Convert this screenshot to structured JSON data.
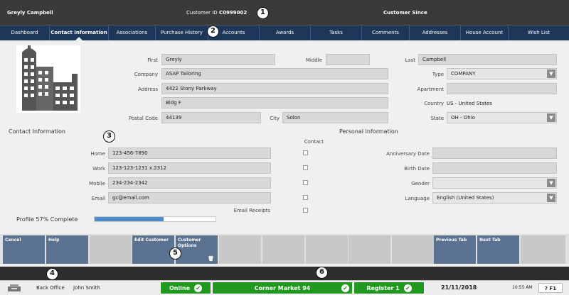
{
  "header": {
    "customer_name": "Greyly Campbell",
    "customer_id_label": "Customer ID",
    "customer_id": "C0999002",
    "customer_since_label": "Customer Since"
  },
  "callouts": [
    "1",
    "2",
    "3",
    "4",
    "5",
    "6"
  ],
  "tabs": [
    {
      "label": "Dashboard"
    },
    {
      "label": "Contact Information",
      "active": true
    },
    {
      "label": "Associations"
    },
    {
      "label": "Purchase History"
    },
    {
      "label": "Accounts"
    },
    {
      "label": "Awards"
    },
    {
      "label": "Tasks"
    },
    {
      "label": "Comments"
    },
    {
      "label": "Addresses"
    },
    {
      "label": "House Account"
    },
    {
      "label": "Wish List"
    }
  ],
  "avatar": "building-image",
  "form": {
    "first_label": "First",
    "first": "Greyly",
    "middle_label": "Middle",
    "middle": "",
    "last_label": "Last",
    "last": "Campbell",
    "company_label": "Company",
    "company": "ASAP Tailoring",
    "type_label": "Type",
    "type": "COMPANY",
    "address_label": "Address",
    "address1": "4422 Stony Parkway",
    "address2": "Bldg F",
    "apartment_label": "Apartment",
    "apartment": "",
    "country_label": "Country",
    "country": "US - United States",
    "postal_label": "Postal Code",
    "postal": "44139",
    "city_label": "City",
    "city": "Solon",
    "state_label": "State",
    "state": "OH - Ohio"
  },
  "contact": {
    "section_title": "Contact Information",
    "contact_col_label": "Contact",
    "home_label": "Home",
    "home": "123-456-7890",
    "work_label": "Work",
    "work": "123-123-1231 x.2312",
    "mobile_label": "Mobile",
    "mobile": "234-234-2342",
    "email_label": "Email",
    "email": "gc@email.com",
    "email_receipts_label": "Email Receipts"
  },
  "personal": {
    "section_title": "Personal Information",
    "anniversary_label": "Anniversary Date",
    "anniversary": "",
    "birth_label": "Birth Date",
    "birth": "",
    "gender_label": "Gender",
    "gender": "",
    "language_label": "Language",
    "language": "English (United States)"
  },
  "profile": {
    "text": "Profile 57% Complete",
    "percent": 57
  },
  "buttons": [
    {
      "label": "Cancel"
    },
    {
      "label": "Help"
    },
    {
      "label": ""
    },
    {
      "label": "Edit Customer"
    },
    {
      "label": "Customer Options"
    },
    {
      "label": ""
    },
    {
      "label": ""
    },
    {
      "label": ""
    },
    {
      "label": ""
    },
    {
      "label": ""
    },
    {
      "label": "Previous Tab"
    },
    {
      "label": "Next Tab"
    },
    {
      "label": ""
    }
  ],
  "status": {
    "back_office": "Back Office",
    "user": "John Smith",
    "online": "Online",
    "store": "Corner Market 94",
    "register": "Register 1",
    "date": "21/11/2018",
    "time": "10:55 AM",
    "help": "F1"
  },
  "colors": {
    "nav": "#1e3658",
    "button": "#5b7290",
    "status_green": "#1f9a1f",
    "progress": "#4f8ac9"
  }
}
